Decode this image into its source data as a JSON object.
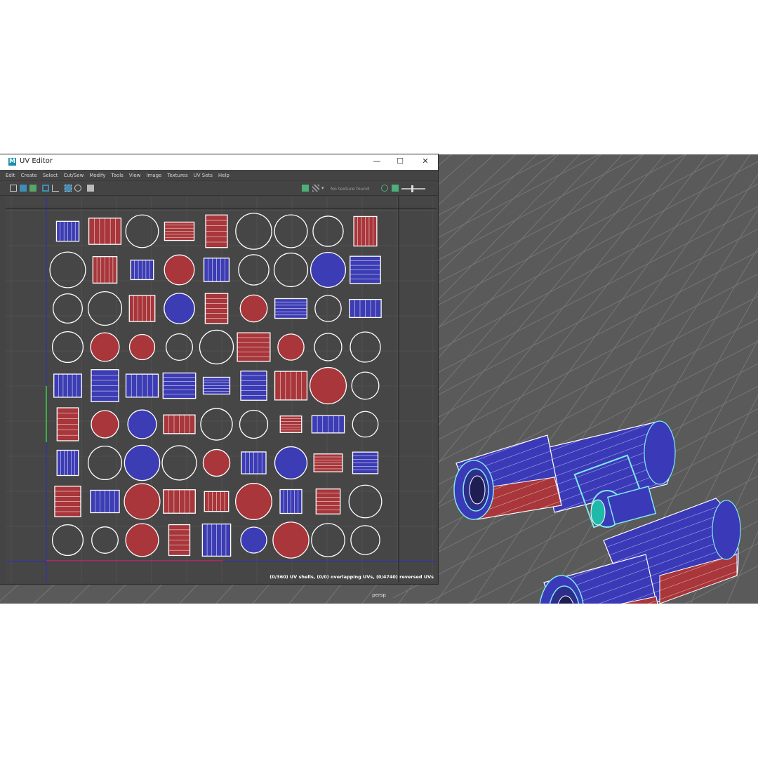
{
  "window": {
    "title": "UV Editor",
    "app_icon": "M",
    "minimize_icon": "minimize-icon",
    "maximize_icon": "maximize-icon",
    "close_icon": "close-icon"
  },
  "menu": [
    "Edit",
    "Create",
    "Select",
    "Cut/Sew",
    "Modify",
    "Tools",
    "View",
    "Image",
    "Textures",
    "UV Sets",
    "Help"
  ],
  "toolbar": {
    "texture_status": "No texture found",
    "icons": [
      "uv-grid-icon",
      "checker-shading-icon",
      "texture-tile-icon",
      "frame-icon",
      "uv-border-icon",
      "snap-grid-icon",
      "isolate-icon",
      "snapshot-icon",
      "image-display-icon",
      "checker-icon",
      "dropdown-icon",
      "refresh-icon",
      "exposure-icon",
      "exposure-slider"
    ]
  },
  "status": {
    "uv_summary": "(0/360) UV shells, (0/0) overlapping UVs, (0/4740) reversed UVs"
  },
  "viewport": {
    "camera": "persp"
  },
  "colors": {
    "uv_red": "#a8363a",
    "uv_blue": "#3c3cb4",
    "uv_edge": "#ffffff",
    "viewport_bg": "#5a5a5a",
    "grid_line": "#757575",
    "wire_cyan": "#7fe9ee"
  }
}
